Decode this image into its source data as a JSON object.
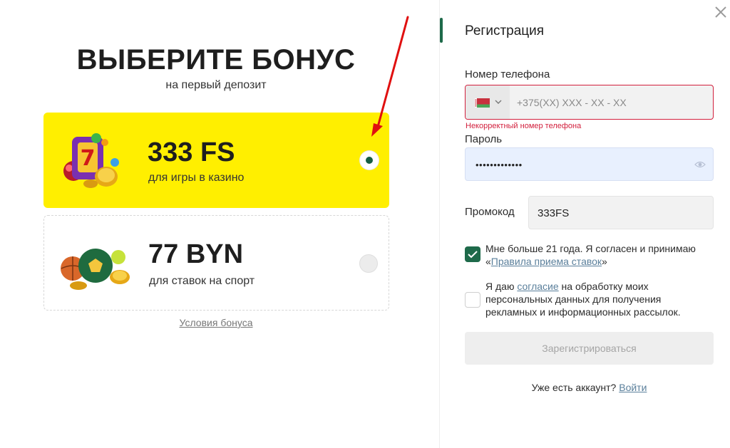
{
  "left": {
    "headline": "ВЫБЕРИТЕ БОНУС",
    "subline": "на первый депозит",
    "bonuses": [
      {
        "amount": "333 FS",
        "description": "для игры в казино",
        "selected": true,
        "icon": "casino-slot-icon"
      },
      {
        "amount": "77 BYN",
        "description": "для ставок на спорт",
        "selected": false,
        "icon": "sport-balls-icon"
      }
    ],
    "conditions_link": "Условия бонуса"
  },
  "form": {
    "title": "Регистрация",
    "phone_label": "Номер телефона",
    "phone_placeholder": "+375(XX) XXX - XX - XX",
    "country_flag": "belarus-flag-icon",
    "phone_error": "Некорректный номер телефона",
    "password_label": "Пароль",
    "password_value": "•••••••••••••",
    "promo_label": "Промокод",
    "promo_value": "333FS",
    "age_consent": {
      "checked": true,
      "text_before": "Мне больше 21 года. Я согласен и принимаю «",
      "link": "Правила приема ставок",
      "text_after": "»"
    },
    "data_consent": {
      "checked": false,
      "text_before": "Я даю ",
      "link": "согласие",
      "text_after": " на обработку моих персональных данных для получения рекламных и информационных рассылок."
    },
    "submit_label": "Зарегистрироваться",
    "login_prompt": "Уже есть аккаунт?",
    "login_link": "Войти"
  },
  "colors": {
    "accent_green": "#1e6a4a",
    "selected_card": "#ffef00",
    "error_red": "#d21f3c",
    "annotation_arrow": "#e01010"
  }
}
